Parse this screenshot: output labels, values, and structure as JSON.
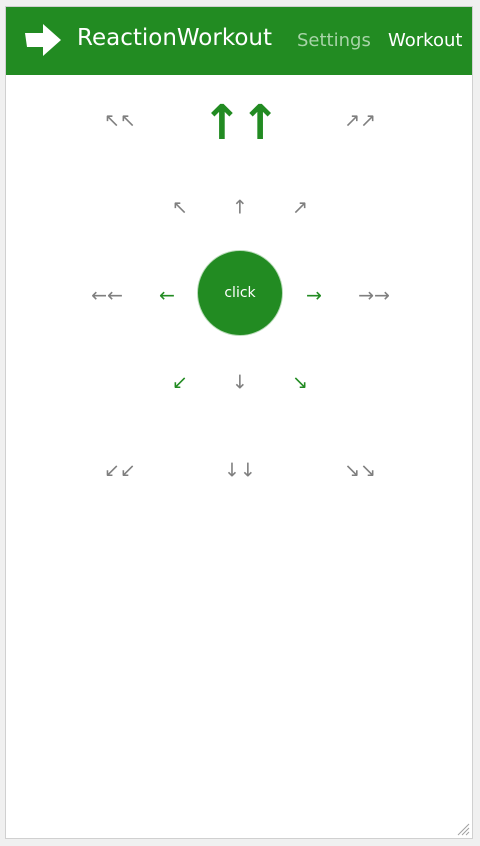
{
  "app": {
    "title": "ReactionWorkout",
    "logo_icon": "right-arrow-icon",
    "accent_color": "#228b22",
    "nav": {
      "settings_label": "Settings",
      "workout_label": "Workout"
    }
  },
  "pad": {
    "center_label": "click",
    "arrows": {
      "far_up_left": "↖↖",
      "far_up": "↑↑",
      "far_up_right": "↗↗",
      "up_left": "↖",
      "up": "↑",
      "up_right": "↗",
      "far_left": "←←",
      "left": "←",
      "right": "→",
      "far_right": "→→",
      "down_left": "↙",
      "down": "↓",
      "down_right": "↘",
      "far_down_left": "↙↙",
      "far_down": "↓↓",
      "far_down_right": "↘↘"
    },
    "highlighted": [
      "far_up",
      "left",
      "right",
      "down_left",
      "down_right"
    ]
  }
}
